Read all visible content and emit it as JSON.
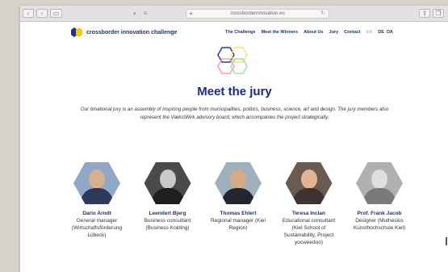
{
  "browser": {
    "url": "crossborderinnovation.eu",
    "back_icon": "chevron-left-icon",
    "forward_icon": "chevron-right-icon",
    "sidebar_icon": "sidebar-icon",
    "reload_icon": "reload-icon",
    "share_icon": "share-icon",
    "tabs_icon": "tabs-icon"
  },
  "header": {
    "brand": "crossborder innovation challenge",
    "nav": [
      {
        "label": "The Challenge"
      },
      {
        "label": "Meet the Winners"
      },
      {
        "label": "About Us"
      },
      {
        "label": "Jury"
      },
      {
        "label": "Contact"
      }
    ],
    "languages": [
      "EN",
      "DE",
      "DA"
    ]
  },
  "main": {
    "title": "Meet the jury",
    "intro": "Our binational jury is an assembly of inspiring people from municipalities, politics, business, science, art and design. The jury members also represent the VækstWirk advisory board, which accompanies the project strategically."
  },
  "jury": [
    {
      "name": "Dario Arndt",
      "role": "General manager (Wirtschaftsförderung Lübeck)"
    },
    {
      "name": "Leendert Bjerg",
      "role": "Business consultant (Business Kolding)"
    },
    {
      "name": "Thomas Ehlert",
      "role": "Regional manager (Kiel Region)"
    },
    {
      "name": "Teresa Inclan",
      "role": "Educational consultant (Kiel School of Sustainability, Project yocweedoo)"
    },
    {
      "name": "Prof. Frank Jacob",
      "role": "Designer (Muthesius Kunsthochschule Kiel)"
    }
  ],
  "colors": {
    "brand_navy": "#1f2f5c",
    "title_blue": "#1a2a8a",
    "logo_yellow": "#f3c913",
    "hex_pink": "#f0a0b4",
    "hex_green": "#a6dca0",
    "hex_yellow": "#f5e27a"
  }
}
